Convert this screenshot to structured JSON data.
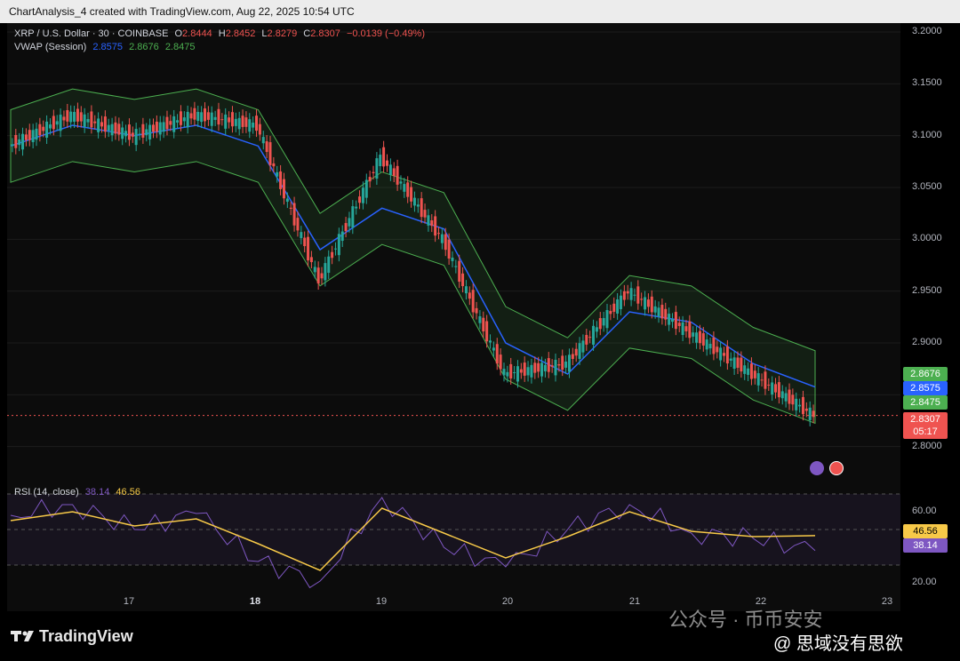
{
  "caption": "ChartAnalysis_4 created with TradingView.com, Aug 22, 2025 10:54 UTC",
  "legend": {
    "symbol": "XRP / U.S. Dollar · 30 · COINBASE",
    "open_label": "O",
    "open": "2.8444",
    "high_label": "H",
    "high": "2.8452",
    "low_label": "L",
    "low": "2.8279",
    "close_label": "C",
    "close": "2.8307",
    "change": "−0.0139 (−0.49%)",
    "vwap_label": "VWAP (Session)",
    "vwap_mid": "2.8575",
    "vwap_upper": "2.8676",
    "vwap_lower": "2.8475"
  },
  "rsi_legend": {
    "label": "RSI (14, close)",
    "rsi": "38.14",
    "ma": "46.56"
  },
  "price_tags": {
    "upper": "2.8676",
    "mid": "2.8575",
    "lower": "2.8475",
    "last": "2.8307",
    "countdown": "05:17",
    "rsi_ma": "46.56",
    "rsi": "38.14"
  },
  "y_ticks": [
    "3.2000",
    "3.1500",
    "3.1000",
    "3.0500",
    "3.0000",
    "2.9500",
    "2.9000",
    "2.8000"
  ],
  "rsi_ticks": [
    "60.00",
    "20.00"
  ],
  "x_ticks": [
    {
      "label": "17",
      "bold": false
    },
    {
      "label": "18",
      "bold": true
    },
    {
      "label": "19",
      "bold": false
    },
    {
      "label": "20",
      "bold": false
    },
    {
      "label": "21",
      "bold": false
    },
    {
      "label": "22",
      "bold": false
    },
    {
      "label": "23",
      "bold": false
    }
  ],
  "brand": "TradingView",
  "watermark": {
    "line1": "公众号 · 币币安安",
    "line2": "@ 思域没有思欲"
  },
  "colors": {
    "up": "#26a69a",
    "down": "#ef5350",
    "vwap": "#2962ff",
    "band": "#4caf50",
    "rsi": "#7e57c2",
    "rsi_ma": "#f7c948"
  },
  "chart_data": [
    {
      "type": "line",
      "title": "XRP / U.S. Dollar · 30 · COINBASE",
      "xlabel": "",
      "ylabel": "",
      "categories": [
        "16",
        "16.5",
        "17",
        "17.5",
        "18",
        "18.5",
        "19",
        "19.5",
        "20",
        "20.5",
        "21",
        "21.5",
        "22",
        "22.3"
      ],
      "series": [
        {
          "name": "XRP / U.S. Dollar",
          "values": [
            3.09,
            3.12,
            3.1,
            3.12,
            3.11,
            2.96,
            3.08,
            3.0,
            2.87,
            2.88,
            2.95,
            2.91,
            2.87,
            2.83
          ]
        },
        {
          "name": "VWAP (Session)",
          "values": [
            3.09,
            3.11,
            3.1,
            3.11,
            3.09,
            2.99,
            3.03,
            3.01,
            2.9,
            2.87,
            2.93,
            2.92,
            2.88,
            2.8575
          ]
        }
      ],
      "ylim": [
        2.78,
        3.2
      ]
    },
    {
      "type": "line",
      "title": "RSI (14, close)",
      "categories": [
        "16",
        "16.5",
        "17",
        "17.5",
        "18",
        "18.5",
        "19",
        "19.5",
        "20",
        "20.5",
        "21",
        "21.5",
        "22",
        "22.3"
      ],
      "series": [
        {
          "name": "RSI (14, close)",
          "values": [
            58,
            64,
            50,
            59,
            32,
            21,
            68,
            40,
            29,
            50,
            64,
            48,
            45,
            38.14
          ]
        },
        {
          "name": "RSI-based MA",
          "values": [
            55,
            60,
            52,
            56,
            42,
            27,
            62,
            48,
            34,
            46,
            60,
            49,
            46,
            46.56
          ]
        }
      ],
      "ylim": [
        15,
        75
      ]
    }
  ]
}
